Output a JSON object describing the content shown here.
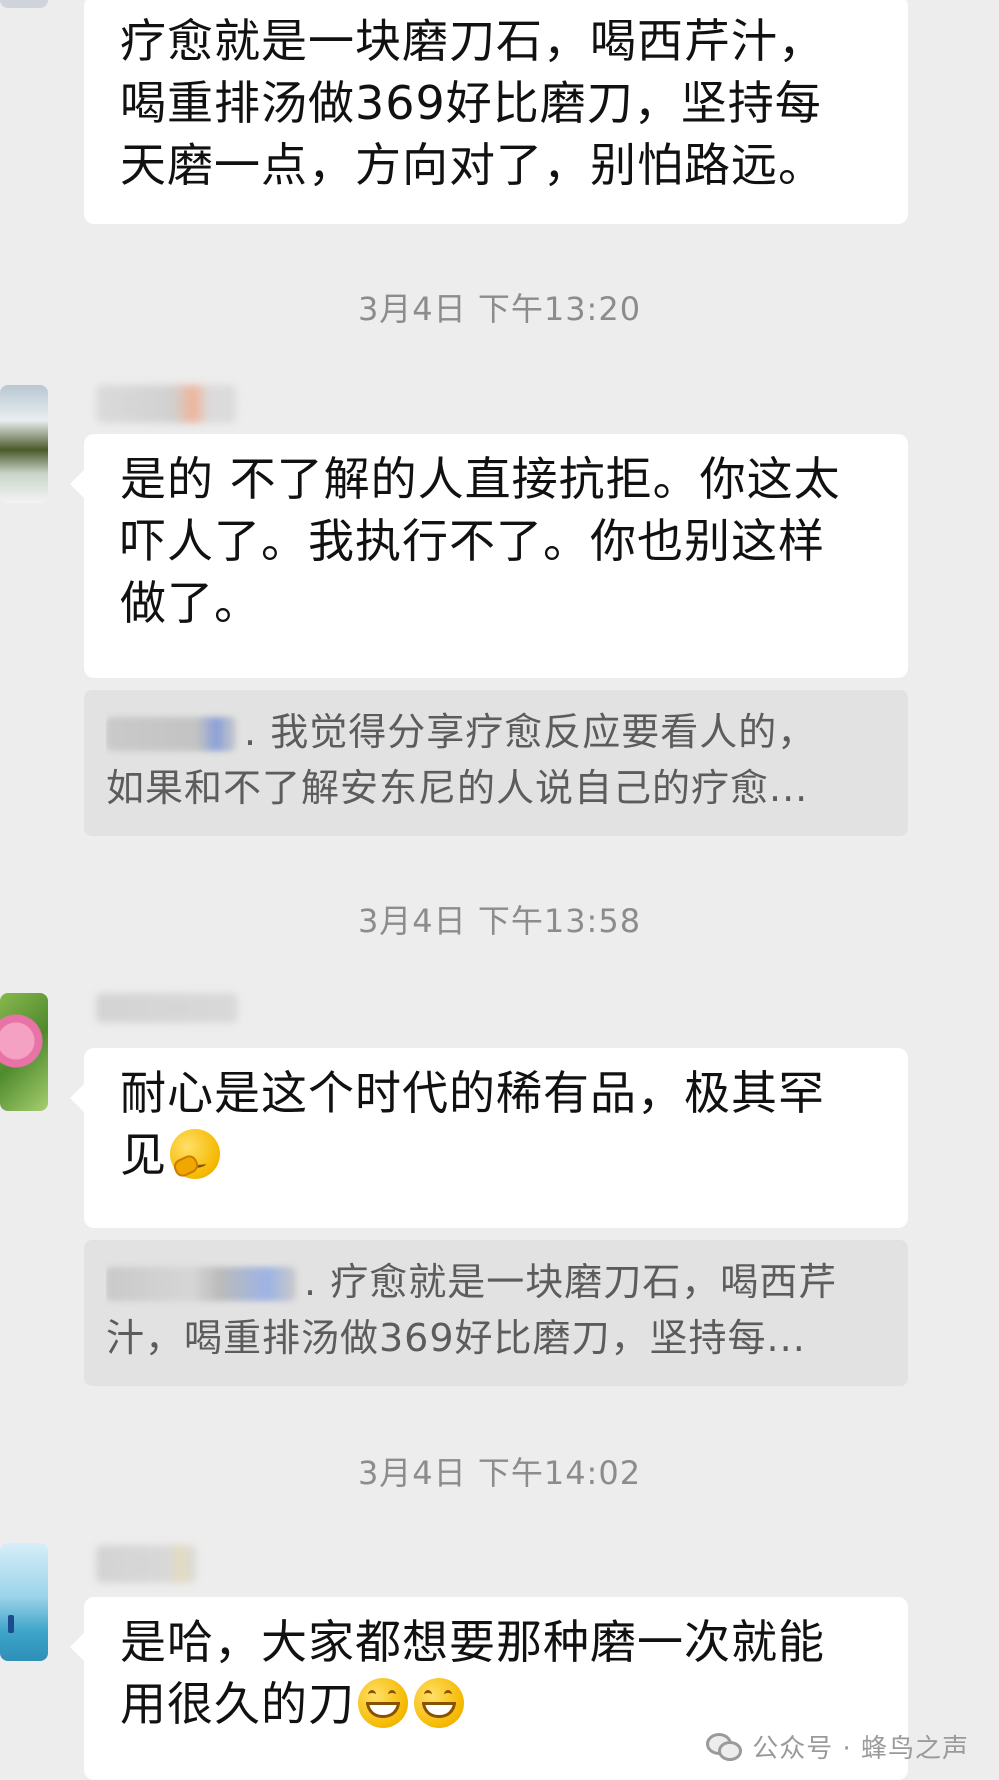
{
  "messages": [
    {
      "lines": [
        "疗愈就是一块磨刀石，喝西芹汁，",
        "喝重排汤做369好比磨刀，坚持每",
        "天磨一点，方向对了，别怕路远。"
      ]
    },
    {
      "lines": [
        "是的 不了解的人直接抗拒。你这太",
        "吓人了。我执行不了。你也别这样",
        "做了。"
      ],
      "quote": [
        "我觉得分享疗愈反应要看人的，",
        "如果和不了解安东尼的人说自己的疗愈..."
      ],
      "quote_separator": "."
    },
    {
      "lines": [
        "耐心是这个时代的稀有品，极其罕",
        "见"
      ],
      "emoji": "thinking-face",
      "quote": [
        "疗愈就是一块磨刀石，喝西芹",
        "汁，喝重排汤做369好比磨刀，坚持每..."
      ],
      "quote_separator": "."
    },
    {
      "lines": [
        "是哈，大家都想要那种磨一次就能",
        "用很久的刀"
      ],
      "emoji": "grinning-face"
    }
  ],
  "timestamps": [
    "3月4日 下午13:20",
    "3月4日 下午13:58",
    "3月4日 下午14:02"
  ],
  "watermark": {
    "text": "公众号 · 蜂鸟之声",
    "icon": "wechat-icon"
  },
  "colors": {
    "background": "#ededed",
    "bubble": "#ffffff",
    "quote": "#e2e2e2",
    "timestamp": "#8c8c8c"
  }
}
